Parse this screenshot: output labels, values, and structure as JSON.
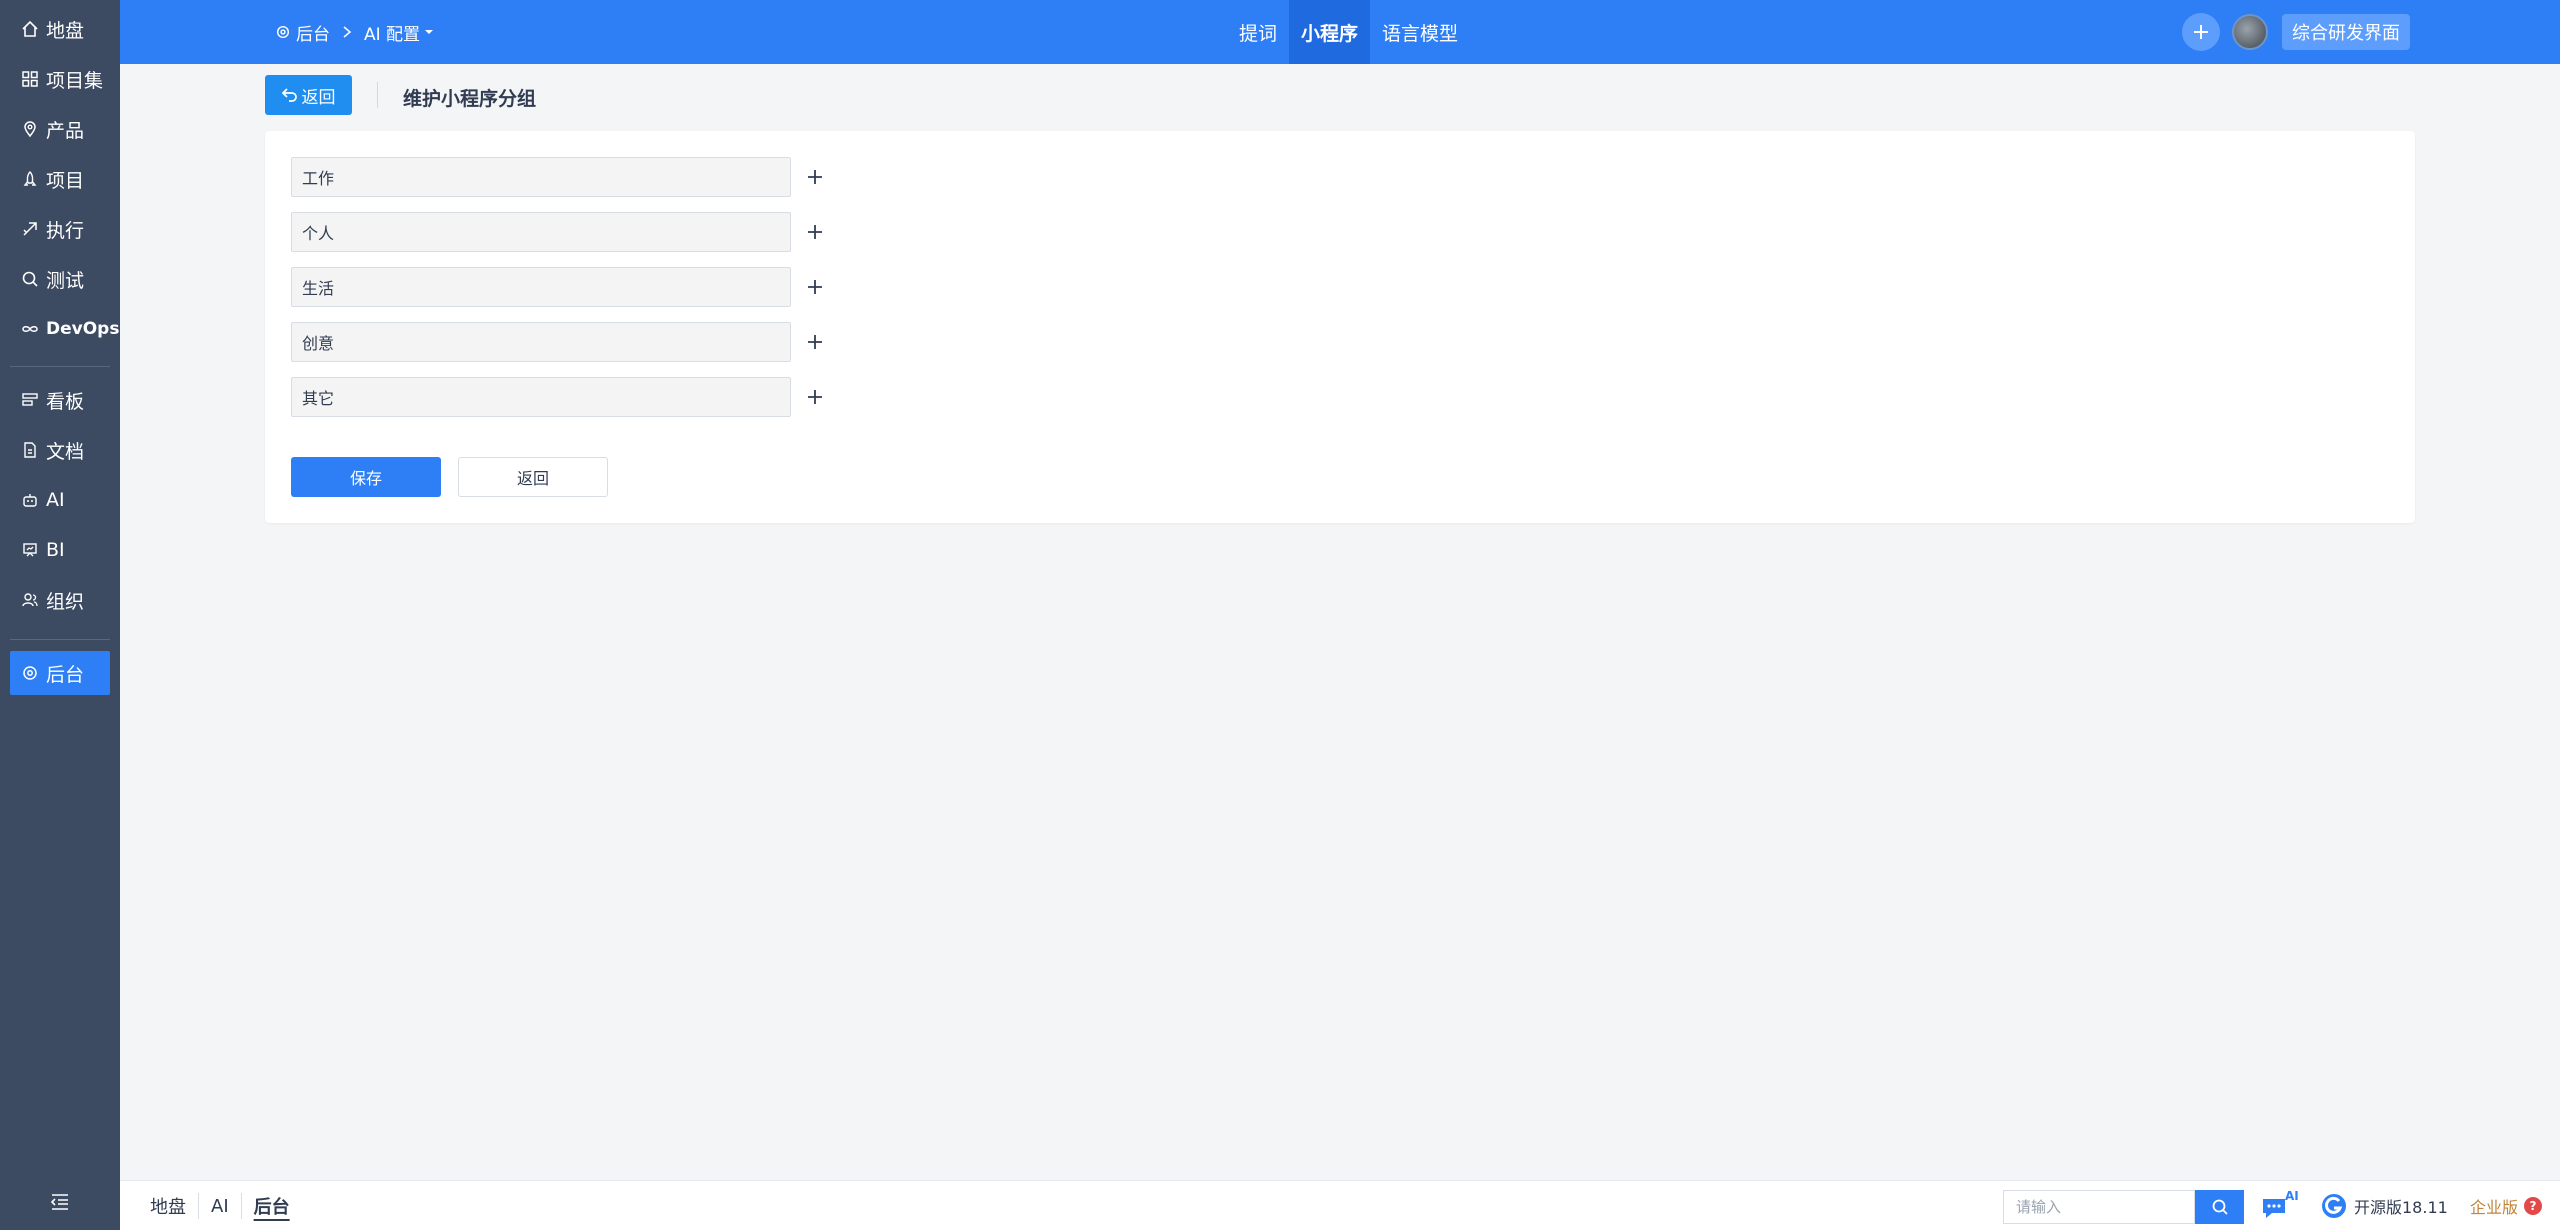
{
  "sidebar": {
    "items": [
      {
        "label": "地盘",
        "icon": "home-icon"
      },
      {
        "label": "项目集",
        "icon": "grid-icon"
      },
      {
        "label": "产品",
        "icon": "location-pin-icon"
      },
      {
        "label": "项目",
        "icon": "rocket-icon"
      },
      {
        "label": "执行",
        "icon": "send-icon"
      },
      {
        "label": "测试",
        "icon": "magnifier-icon"
      },
      {
        "label": "DevOps",
        "icon": "infinity-icon"
      },
      {
        "label": "看板",
        "icon": "kanban-icon"
      },
      {
        "label": "文档",
        "icon": "document-icon"
      },
      {
        "label": "AI",
        "icon": "robot-icon"
      },
      {
        "label": "BI",
        "icon": "presentation-icon"
      },
      {
        "label": "组织",
        "icon": "users-icon"
      },
      {
        "label": "后台",
        "icon": "settings-icon",
        "active": true
      }
    ]
  },
  "header": {
    "breadcrumb": {
      "root": "后台",
      "current": "AI 配置"
    },
    "tabs": [
      {
        "label": "提词"
      },
      {
        "label": "小程序",
        "active": true
      },
      {
        "label": "语言模型"
      }
    ],
    "workspace_button": "综合研发界面"
  },
  "main": {
    "back_label": "返回",
    "title": "维护小程序分组",
    "groups": [
      "工作",
      "个人",
      "生活",
      "创意",
      "其它"
    ],
    "save_label": "保存",
    "cancel_label": "返回"
  },
  "footer": {
    "tabs": [
      {
        "label": "地盘"
      },
      {
        "label": "AI"
      },
      {
        "label": "后台",
        "active": true
      }
    ],
    "search_placeholder": "请输入",
    "ai_badge": "AI",
    "version": "开源版18.11",
    "enterprise": "企业版",
    "enterprise_help": "?"
  },
  "colors": {
    "primary": "#2e7ff6",
    "sidebar": "#3c4a62",
    "back_button": "#1f8ef0",
    "enterprise": "#c0843a"
  }
}
